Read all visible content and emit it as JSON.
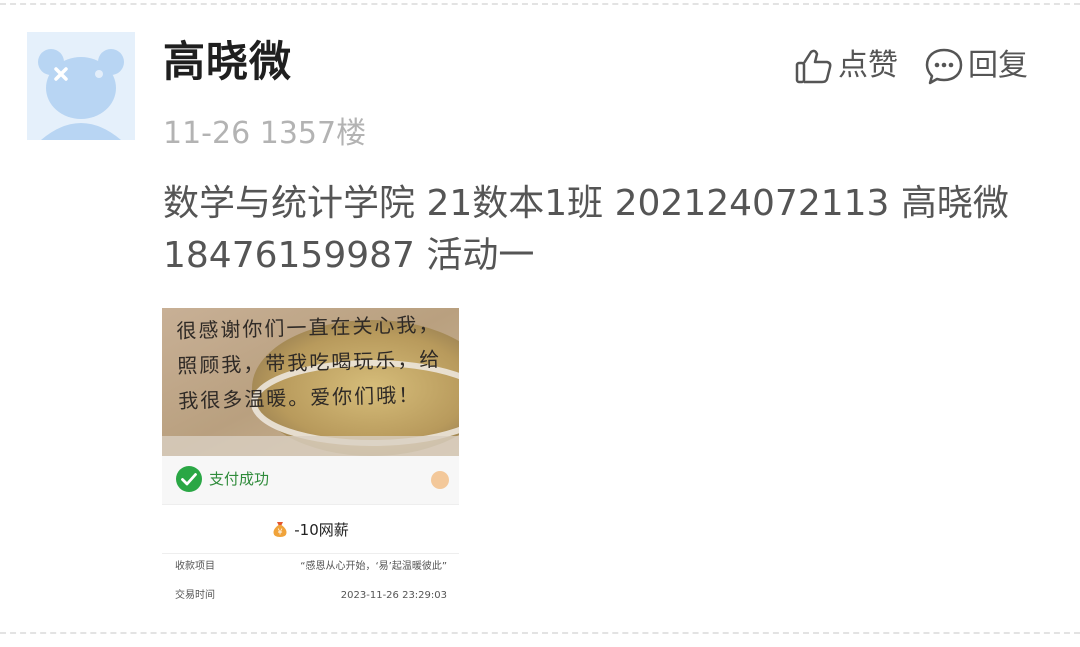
{
  "post": {
    "username": "高晓微",
    "date": "11-26",
    "floor": "1357楼",
    "content": "数学与统计学院 21数本1班 202124072113 高晓微 18476159987 活动一"
  },
  "actions": {
    "like_label": "点赞",
    "reply_label": "回复"
  },
  "icons": {
    "like": "thumbs-up-icon",
    "reply": "speech-bubble-icon",
    "avatar": "bear-avatar-icon",
    "pay_success": "check-circle-icon",
    "money_bag": "money-bag-icon"
  },
  "attachment": {
    "handwritten_note": "很感谢你们一直在关心我，照顾我，带我吃喝玩乐，给我很多温暖。爱你们哦！",
    "pay_status": "支付成功",
    "amount": "-10网薪",
    "rows": [
      {
        "label": "收款项目",
        "value": "“感恩从心开始，‘易’起温暖彼此”"
      },
      {
        "label": "交易时间",
        "value": "2023-11-26 23:29:03"
      }
    ]
  },
  "colors": {
    "meta_gray": "#b3b3b3",
    "text_gray": "#555555",
    "pay_green": "#2e8b3a",
    "avatar_bg": "#e5f0fb"
  }
}
